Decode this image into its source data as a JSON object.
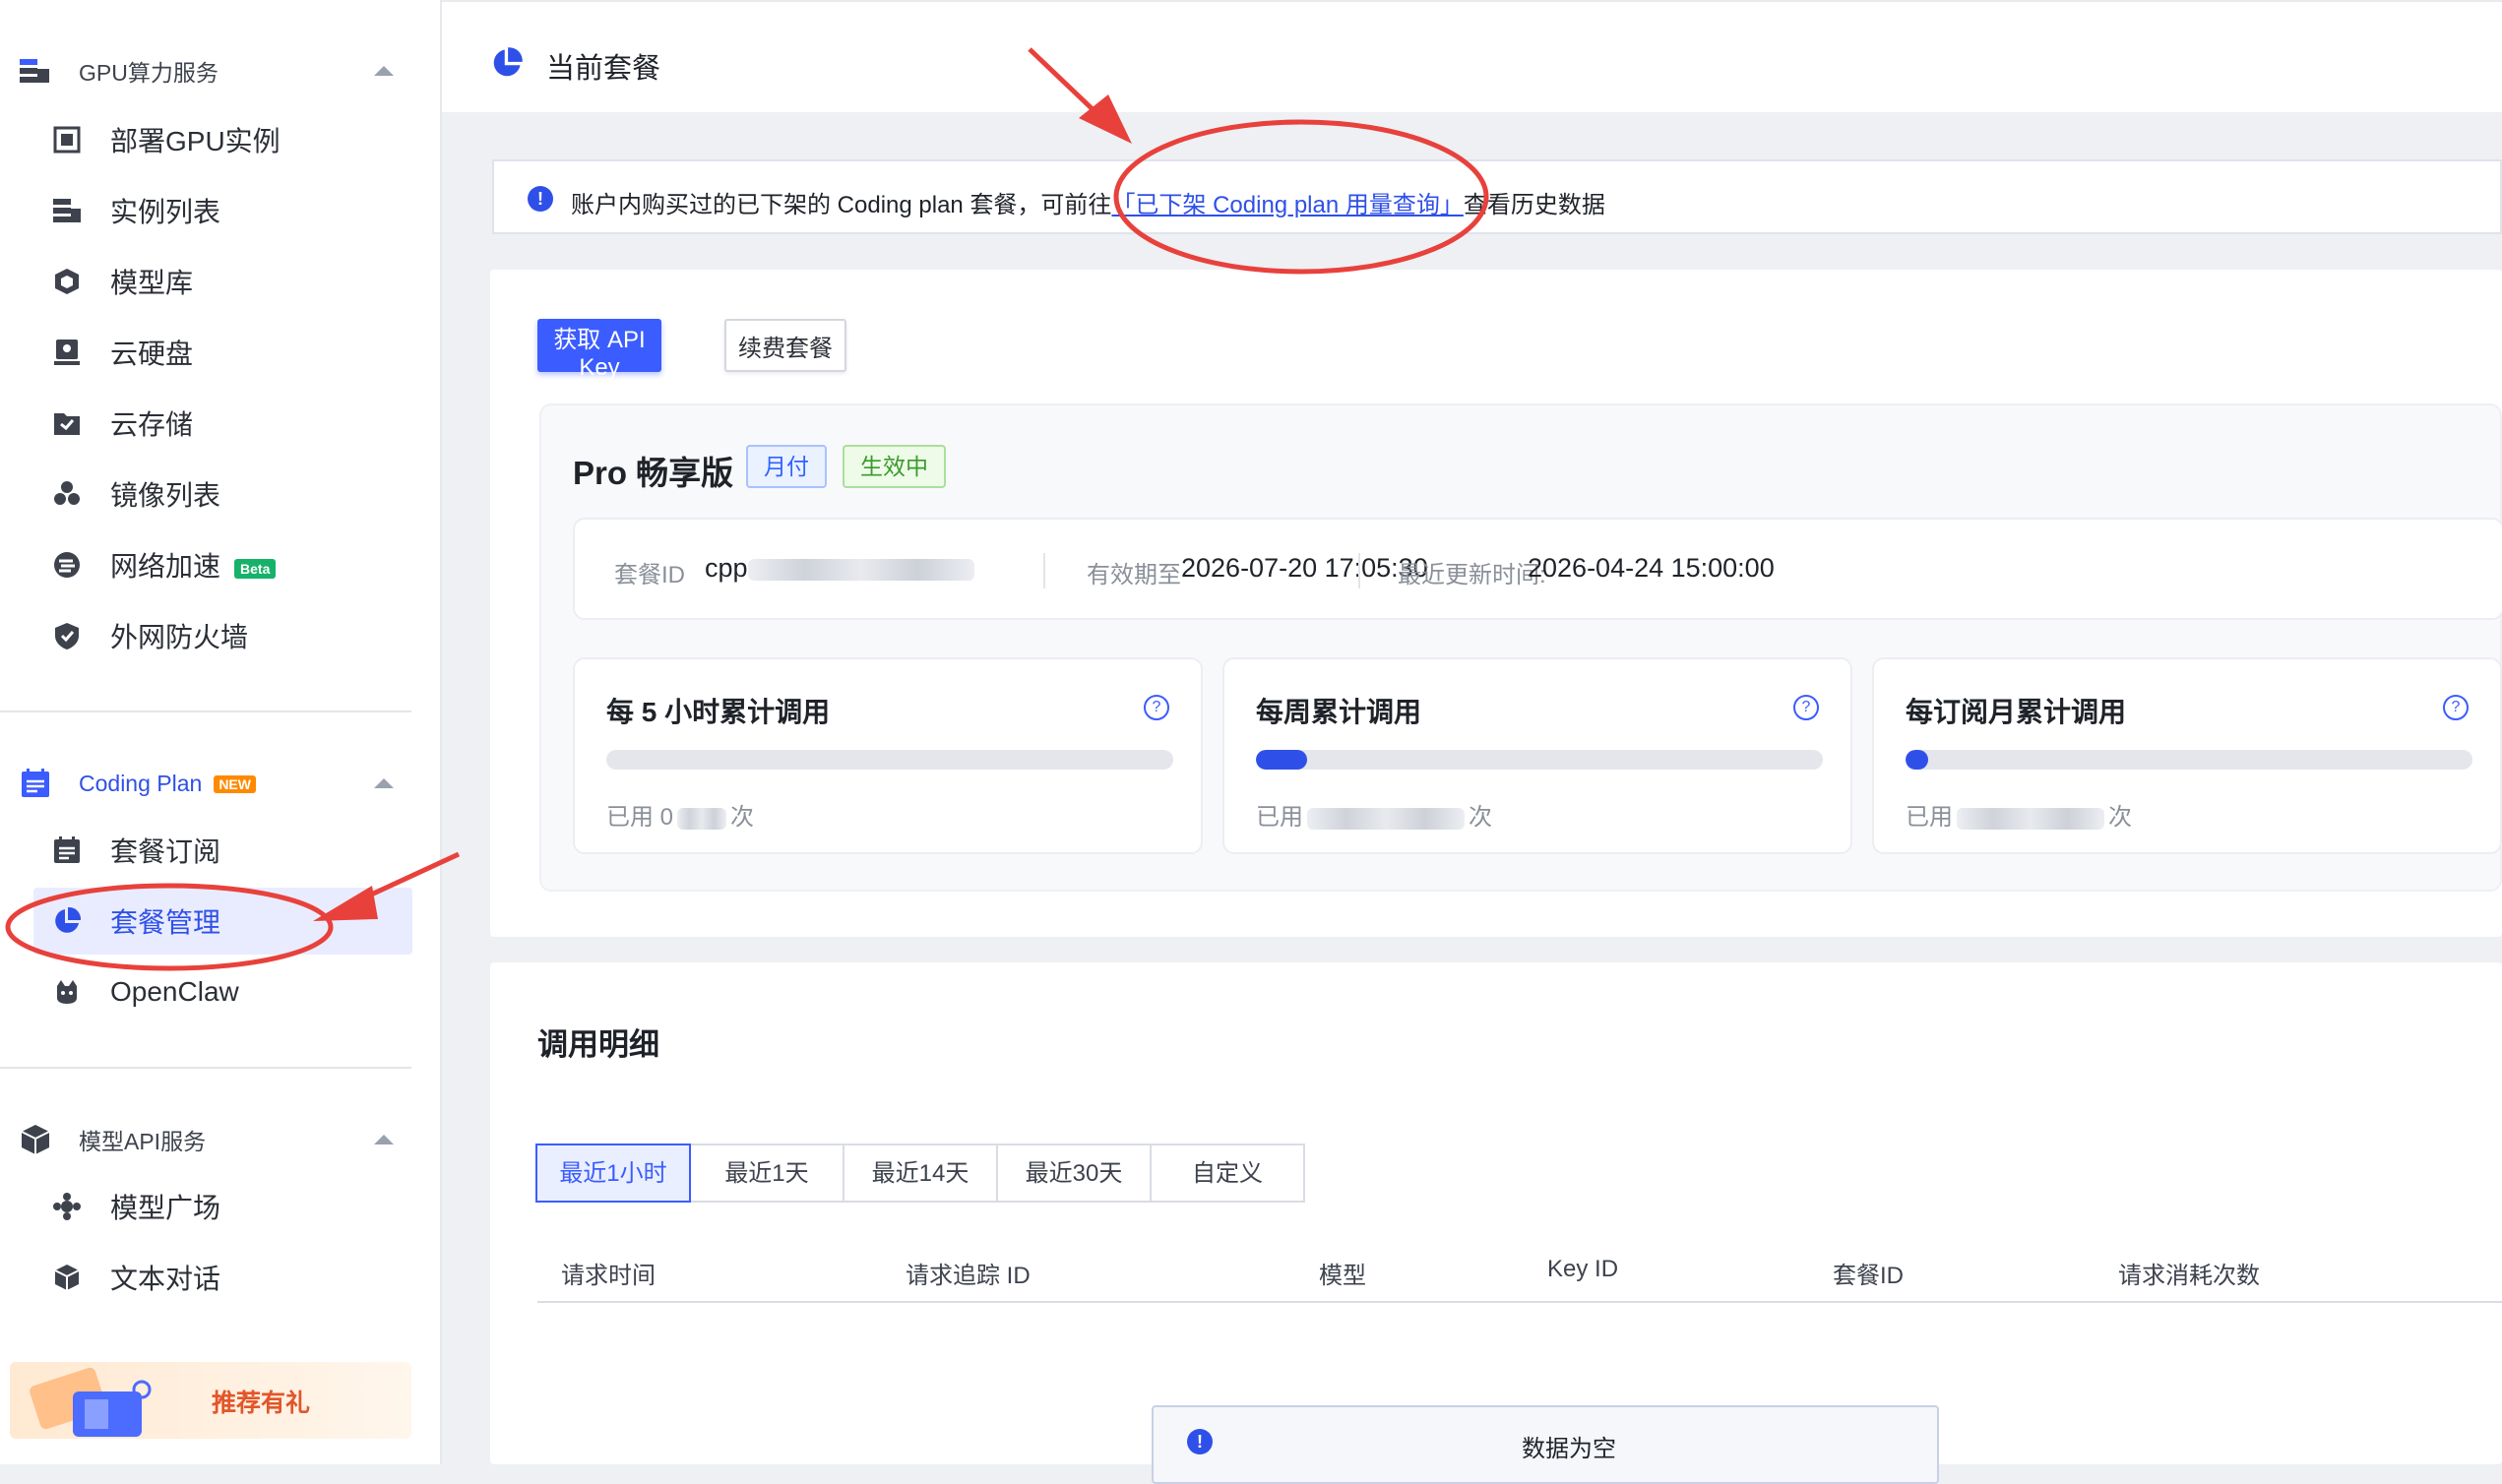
{
  "sidebar": {
    "groups": [
      {
        "label": "GPU算力服务",
        "icon": "server-icon",
        "items": [
          {
            "label": "部署GPU实例",
            "icon": "deploy-icon"
          },
          {
            "label": "实例列表",
            "icon": "instance-list-icon"
          },
          {
            "label": "模型库",
            "icon": "model-library-icon"
          },
          {
            "label": "云硬盘",
            "icon": "cloud-disk-icon"
          },
          {
            "label": "云存储",
            "icon": "cloud-storage-icon"
          },
          {
            "label": "镜像列表",
            "icon": "image-list-icon"
          },
          {
            "label": "网络加速",
            "icon": "network-accel-icon",
            "badge": "Beta"
          },
          {
            "label": "外网防火墙",
            "icon": "shield-icon"
          }
        ]
      },
      {
        "label": "Coding Plan",
        "badge": "NEW",
        "icon": "coding-plan-icon",
        "items": [
          {
            "label": "套餐订阅",
            "icon": "subscription-icon"
          },
          {
            "label": "套餐管理",
            "icon": "pie-chart-icon",
            "active": true
          },
          {
            "label": "OpenClaw",
            "icon": "openclaw-icon"
          }
        ]
      },
      {
        "label": "模型API服务",
        "icon": "cube-icon",
        "items": [
          {
            "label": "模型广场",
            "icon": "model-plaza-icon"
          },
          {
            "label": "文本对话",
            "icon": "text-chat-icon"
          }
        ]
      }
    ],
    "promo_label": "推荐有礼"
  },
  "header": {
    "title": "当前套餐",
    "icon": "pie-chart-icon"
  },
  "notice": {
    "prefix": "账户内购买过的已下架的 Coding plan 套餐，可前往",
    "link": "「已下架 Coding plan 用量查询」",
    "suffix": "查看历史数据"
  },
  "actions": {
    "api_key": "获取 API Key",
    "renew": "续费套餐"
  },
  "plan": {
    "name": "Pro 畅享版",
    "tag_billing": "月付",
    "tag_status": "生效中",
    "id_label": "套餐ID",
    "id_value": "cpp",
    "expiry_label": "有效期至",
    "expiry_value": "2026-07-20 17:05:30",
    "updated_label": "最近更新时间:",
    "updated_value": "2026-04-24 15:00:00"
  },
  "quotas": [
    {
      "title": "每 5 小时累计调用",
      "used_prefix": "已用 0",
      "used_suffix": "次",
      "progress": 0.0
    },
    {
      "title": "每周累计调用",
      "used_prefix": "已用",
      "used_suffix": "次",
      "progress": 0.09
    },
    {
      "title": "每订阅月累计调用",
      "used_prefix": "已用",
      "used_suffix": "次",
      "progress": 0.04
    }
  ],
  "detail": {
    "title": "调用明细",
    "tabs": [
      "最近1小时",
      "最近1天",
      "最近14天",
      "最近30天",
      "自定义"
    ],
    "active_tab": 0,
    "columns": [
      "请求时间",
      "请求追踪 ID",
      "模型",
      "Key ID",
      "套餐ID",
      "请求消耗次数"
    ],
    "empty_text": "数据为空"
  },
  "colors": {
    "primary": "#3b5cff",
    "active_bg": "#e9ecff",
    "annotation": "#e8413c",
    "success": "#3a9b2c"
  }
}
